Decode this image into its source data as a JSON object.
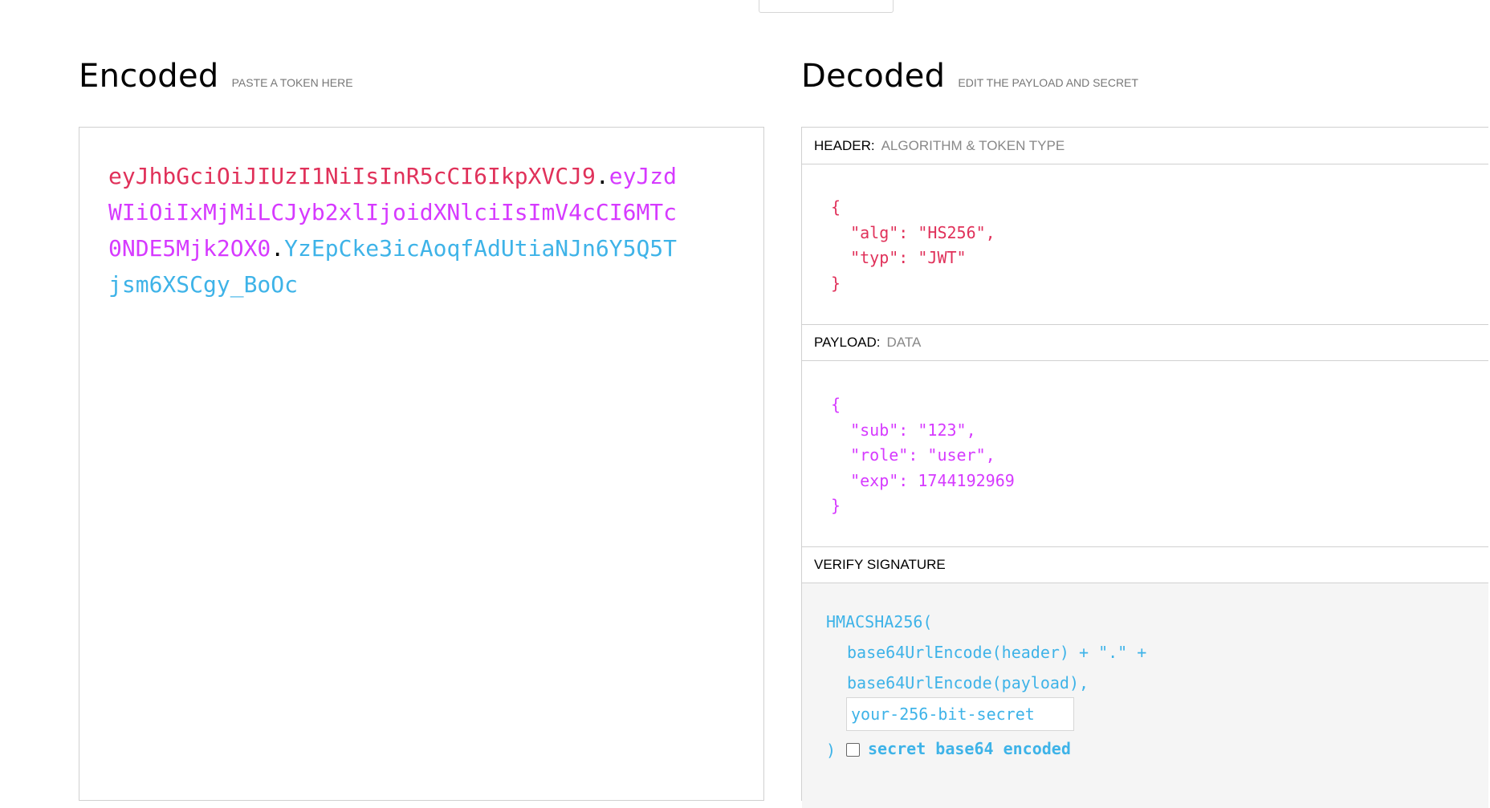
{
  "encoded": {
    "title": "Encoded",
    "subtitle": "PASTE A TOKEN HERE",
    "token": {
      "header": "eyJhbGciOiJIUzI1NiIsInR5cCI6IkpXVCJ9",
      "dot1": ".",
      "payload": "eyJzdWIiOiIxMjMiLCJyb2xlIjoidXNlciIsImV4cCI6MTc0NDE5Mjk2OX0",
      "dot2": ".",
      "signature": "YzEpCke3icAoqfAdUtiaNJn6Y5Q5Tjsm6XSCgy_BoOc"
    }
  },
  "decoded": {
    "title": "Decoded",
    "subtitle": "EDIT THE PAYLOAD AND SECRET",
    "header_section": {
      "label": "HEADER:",
      "desc": "ALGORITHM & TOKEN TYPE",
      "json": "{\n  \"alg\": \"HS256\",\n  \"typ\": \"JWT\"\n}"
    },
    "payload_section": {
      "label": "PAYLOAD:",
      "desc": "DATA",
      "json": "{\n  \"sub\": \"123\",\n  \"role\": \"user\",\n  \"exp\": 1744192969\n}"
    },
    "verify_section": {
      "label": "VERIFY SIGNATURE",
      "fn": "HMACSHA256(",
      "line1": "base64UrlEncode(header) + \".\" +",
      "line2": "base64UrlEncode(payload),",
      "secret_placeholder": "your-256-bit-secret",
      "close": ")",
      "checkbox_label": "secret base64 encoded"
    }
  },
  "colors": {
    "header": "#e0315a",
    "payload": "#d63aff",
    "signature": "#3eb3e8"
  }
}
